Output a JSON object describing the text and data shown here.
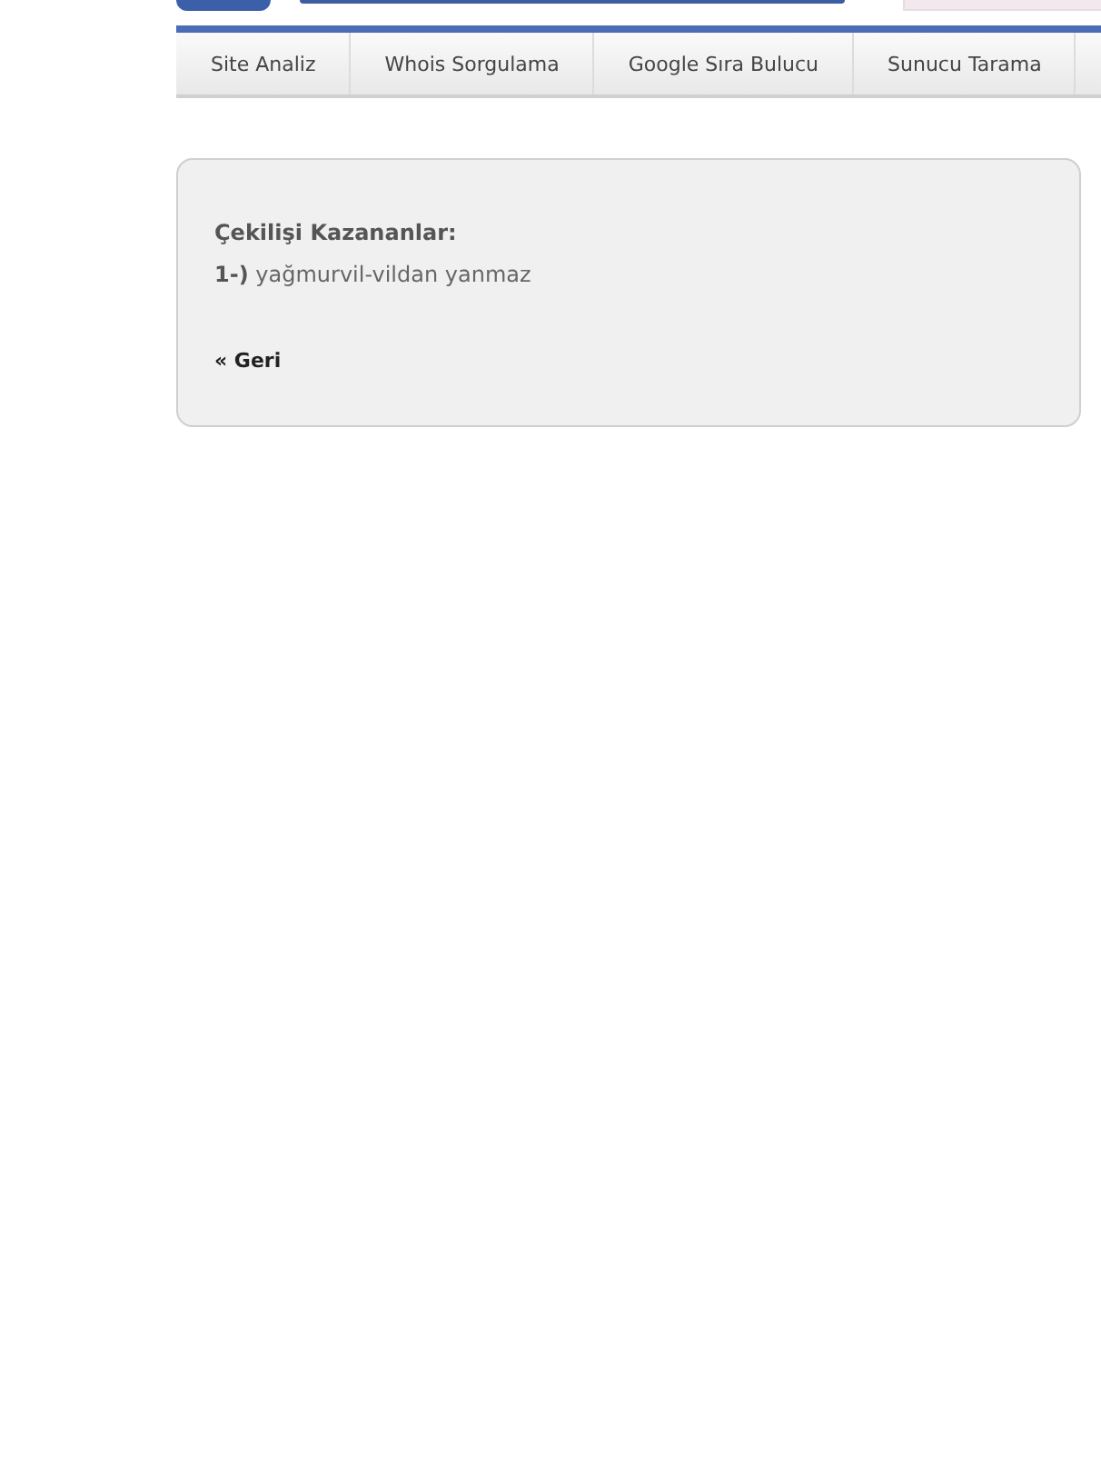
{
  "nav": [
    {
      "label": "Site Analiz"
    },
    {
      "label": "Whois Sorgulama"
    },
    {
      "label": "Google Sıra Bulucu"
    },
    {
      "label": "Sunucu Tarama"
    }
  ],
  "panel": {
    "heading": "Çekilişi Kazananlar:",
    "winners": [
      "**1-)** yağmurvil-vildan yanmaz"
    ],
    "back_link": "« Geri"
  }
}
